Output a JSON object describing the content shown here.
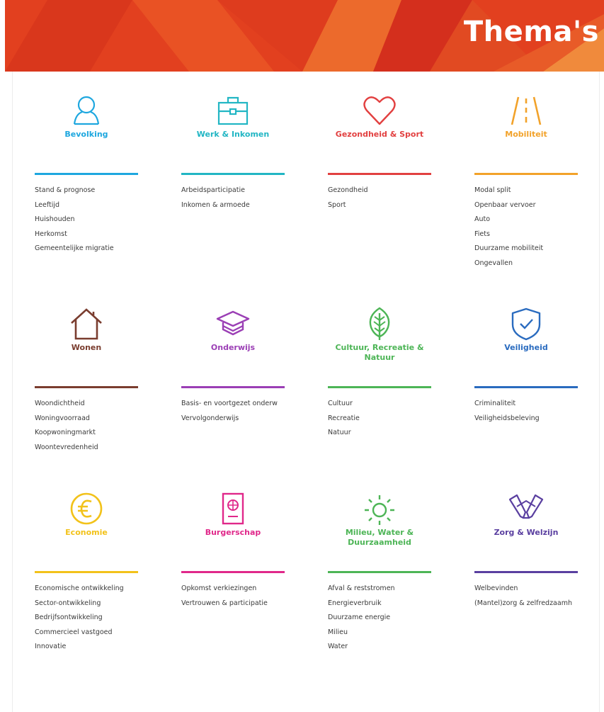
{
  "header": {
    "title": "Thema's"
  },
  "themes": [
    {
      "title": "Bevolking",
      "color": "#1ea7df",
      "icon": "person-icon",
      "items": [
        "Stand & prognose",
        "Leeftijd",
        "Huishouden",
        "Herkomst",
        "Gemeentelijke migratie"
      ]
    },
    {
      "title": "Werk & Inkomen",
      "color": "#22b6c4",
      "icon": "briefcase-icon",
      "items": [
        "Arbeidsparticipatie",
        "Inkomen & armoede"
      ]
    },
    {
      "title": "Gezondheid & Sport",
      "color": "#e24040",
      "icon": "heart-icon",
      "items": [
        "Gezondheid",
        "Sport"
      ]
    },
    {
      "title": "Mobiliteit",
      "color": "#f2a22a",
      "icon": "road-icon",
      "items": [
        "Modal split",
        "Openbaar vervoer",
        "Auto",
        "Fiets",
        "Duurzame mobiliteit",
        "Ongevallen"
      ]
    },
    {
      "title": "Wonen",
      "color": "#7a3d2f",
      "icon": "house-icon",
      "items": [
        "Woondichtheid",
        "Woningvoorraad",
        "Koopwoningmarkt",
        "Woontevredenheid"
      ]
    },
    {
      "title": "Onderwijs",
      "color": "#9b3fb5",
      "icon": "graduation-cap-icon",
      "items": [
        "Basis- en voortgezet onderw",
        "Vervolgonderwijs"
      ]
    },
    {
      "title": "Cultuur, Recreatie & Natuur",
      "color": "#4db556",
      "icon": "leaf-icon",
      "items": [
        "Cultuur",
        "Recreatie",
        "Natuur"
      ]
    },
    {
      "title": "Veiligheid",
      "color": "#2a6bbf",
      "icon": "shield-check-icon",
      "items": [
        "Criminaliteit",
        "Veiligheidsbeleving"
      ]
    },
    {
      "title": "Economie",
      "color": "#f2c21a",
      "icon": "euro-coin-icon",
      "items": [
        "Economische ontwikkeling",
        "Sector-ontwikkeling",
        "Bedrijfsontwikkeling",
        "Commercieel vastgoed",
        "Innovatie"
      ]
    },
    {
      "title": "Burgerschap",
      "color": "#e0288a",
      "icon": "passport-icon",
      "items": [
        "Opkomst verkiezingen",
        "Vertrouwen & participatie"
      ]
    },
    {
      "title": "Milieu, Water & Duurzaamheid",
      "color": "#4db556",
      "icon": "sun-icon",
      "items": [
        "Afval & reststromen",
        "Energieverbruik",
        "Duurzame energie",
        "Milieu",
        "Water"
      ]
    },
    {
      "title": "Zorg & Welzijn",
      "color": "#5a3fa0",
      "icon": "caring-hands-icon",
      "items": [
        "Welbevinden",
        "(Mantel)zorg & zelfredzaamh"
      ]
    }
  ]
}
